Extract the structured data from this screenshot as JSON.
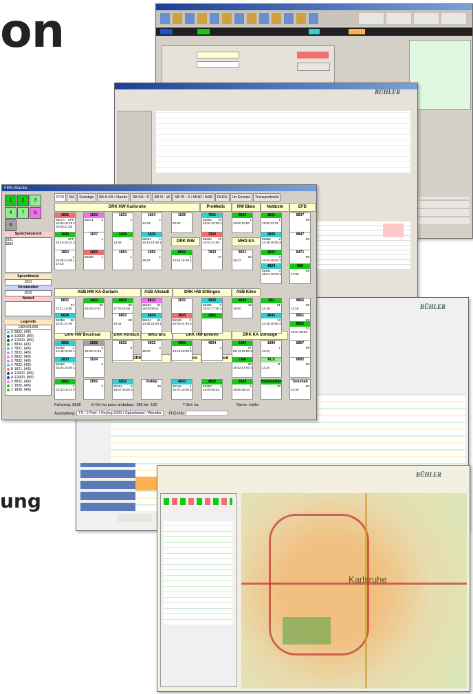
{
  "headings": {
    "line1": "on",
    "line2": "ung"
  },
  "colors": {
    "green": "#14c814",
    "red": "#f07070",
    "cyan": "#30d0d0",
    "magenta": "#f070f0",
    "yellow": "#ffffcc",
    "dark": "#202020",
    "grey": "#a0a0a0",
    "orange": "#ffb050",
    "lightgreen": "#90ee90",
    "pink": "#ffc8c8",
    "white": "#ffffff",
    "blue": "#1c3f94"
  },
  "fms": {
    "title": "FMS-Maske",
    "keypad": [
      "1",
      "2",
      "3",
      "4",
      "7",
      "8",
      "6"
    ],
    "tabs": [
      "RTD",
      "NH",
      "Sonstige",
      "SB A-KA / Hunde",
      "SB KA - N",
      "SB N - W",
      "SB W - Z / MHD / ASB",
      "DLRG",
      "Im Einsatz",
      "Transportziele"
    ],
    "sprechwunsch": {
      "label": "Sprechwunsch",
      "items": [
        "1831",
        "1836"
      ]
    },
    "sprechtaste": {
      "label": "Sprechtaste",
      "value": "1831"
    },
    "verstanden": {
      "label": "Verstanden",
      "value": "3833"
    },
    "notruf": {
      "label": "Notruf"
    },
    "legende": {
      "label": "Legende",
      "code": "1/82/431/836",
      "items": [
        {
          "n": "0",
          "text": "2833, (4/6)"
        },
        {
          "n": "A",
          "text": "E3000, (8/9)"
        },
        {
          "n": "A",
          "text": "E3000, (8/9)"
        },
        {
          "n": "1",
          "text": "8834, (4/6)"
        },
        {
          "n": "2",
          "text": "7831, (4/6)"
        },
        {
          "n": "3",
          "text": "3833, (4/6)"
        },
        {
          "n": "3",
          "text": "8832, (4/6)"
        },
        {
          "n": "3",
          "text": "7832, (4/6)"
        },
        {
          "n": "4",
          "text": "7832, (4/6)"
        },
        {
          "n": "8",
          "text": "1821, (4/6)"
        },
        {
          "n": "A",
          "text": "E3000, (8/9)"
        },
        {
          "n": "A",
          "text": "E3000, (8/9)"
        },
        {
          "n": "3",
          "text": "8832, (4/6)"
        },
        {
          "n": "1",
          "text": "1836, (4/6)"
        },
        {
          "n": "1",
          "text": "1836, (4/6)"
        }
      ]
    },
    "groups": [
      {
        "label": "DRK HW Karlsruhe"
      },
      {
        "label": "ProMedic"
      },
      {
        "label": "RW Blalo"
      },
      {
        "label": "Notärzte"
      },
      {
        "label": "EFD"
      },
      {
        "label": "DRK WW"
      },
      {
        "label": "MHD KA"
      },
      {
        "label": "ASB HW KA-Durlach"
      },
      {
        "label": "ASB Altstadt"
      },
      {
        "label": "DRK HW Ettlingen"
      },
      {
        "label": "ASB Kliko"
      },
      {
        "label": "DRK HW Bruchsal"
      },
      {
        "label": "DRK Kirrlach"
      },
      {
        "label": "MHD Bru"
      },
      {
        "label": "DRK HW Bretten"
      },
      {
        "label": "DRK KA Sonstige"
      },
      {
        "label": "DRK Phil"
      },
      {
        "label": "DRK Menz"
      },
      {
        "label": "DRK Oberd"
      }
    ],
    "cells": [
      {
        "id": "1831",
        "a": "65270",
        "b": "SPP",
        "c": "15:06",
        "d": "18:18",
        "e": "15:44",
        "f": "19:00",
        "g": "21:38"
      },
      {
        "id": "1832",
        "a": "65271",
        "b": "5",
        "c": "",
        "d": "",
        "e": "",
        "f": "",
        "g": ""
      },
      {
        "id": "1833",
        "a": "",
        "b": "1",
        "c": "",
        "d": "",
        "e": "",
        "f": "",
        "g": ""
      },
      {
        "id": "1834",
        "a": "",
        "b": "1",
        "c": "14:33",
        "d": "",
        "e": "",
        "f": "",
        "g": ""
      },
      {
        "id": "1835",
        "a": "",
        "b": "",
        "c": "22:52",
        "d": "",
        "e": "",
        "f": "",
        "g": ""
      },
      {
        "id": "7831",
        "a": "65252",
        "b": "78",
        "c": "15:04",
        "d": "22:00",
        "e": "12:58",
        "f": "",
        "g": ""
      },
      {
        "id": "5831",
        "a": "",
        "b": "1",
        "c": "18:00",
        "d": "10:50",
        "e": "",
        "f": "",
        "g": ""
      },
      {
        "id": "1821",
        "a": "",
        "b": "1",
        "c": "19:00",
        "d": "11:34",
        "e": "",
        "f": "",
        "g": ""
      },
      {
        "id": "8837",
        "a": "",
        "b": "99",
        "c": "",
        "d": "",
        "e": "",
        "f": "",
        "g": ""
      },
      {
        "id": "1836",
        "a": "",
        "b": "SPP",
        "c": "15:18",
        "d": "20:12",
        "e": "18:00",
        "f": "",
        "g": ""
      },
      {
        "id": "1837",
        "a": "",
        "b": "1",
        "c": "",
        "d": "",
        "e": "",
        "f": "",
        "g": ""
      },
      {
        "id": "1838",
        "a": "",
        "b": "1",
        "c": "14:36",
        "d": "",
        "e": "",
        "f": "",
        "g": ""
      },
      {
        "id": "1839",
        "a": "65251",
        "b": "1",
        "c": "15:12",
        "d": "14:36",
        "e": "16:42",
        "f": "",
        "g": ""
      },
      {
        "id": "7832",
        "a": "65264",
        "b": "78",
        "c": "15:01",
        "d": "21:00",
        "e": "",
        "f": "",
        "g": ""
      },
      {
        "id": "2825",
        "a": "65256",
        "b": "2",
        "c": "14:49",
        "d": "19:00",
        "e": "20:11",
        "f": "",
        "g": ""
      },
      {
        "id": "8847",
        "a": "",
        "b": "99",
        "c": "",
        "d": "",
        "e": "",
        "f": "",
        "g": ""
      },
      {
        "id": "1852",
        "a": "",
        "b": "1",
        "c": "13:36",
        "d": "14:58",
        "e": "17:12",
        "f": "17:18",
        "g": ""
      },
      {
        "id": "1853",
        "a": "65265",
        "b": "1",
        "c": "",
        "d": "",
        "e": "",
        "f": "",
        "g": ""
      },
      {
        "id": "1854",
        "a": "",
        "b": "1",
        "c": "",
        "d": "",
        "e": "",
        "f": "",
        "g": ""
      },
      {
        "id": "1855",
        "a": "",
        "b": "1",
        "c": "19:33",
        "d": "",
        "e": "",
        "f": "",
        "g": ""
      },
      {
        "id": "8832",
        "a": "",
        "b": "1",
        "c": "14:51",
        "d": "16:00",
        "e": "15:25",
        "f": "",
        "g": ""
      },
      {
        "id": "7833",
        "a": "",
        "b": "70",
        "c": "",
        "d": "",
        "e": "",
        "f": "",
        "g": ""
      },
      {
        "id": "9831",
        "a": "",
        "b": "90",
        "c": "19:47",
        "d": "",
        "e": "",
        "f": "",
        "g": ""
      },
      {
        "id": "3822",
        "a": "",
        "b": "3",
        "c": "13:54",
        "d": "19:00",
        "e": "11:00",
        "f": "",
        "g": ""
      },
      {
        "id": "8471",
        "a": "",
        "b": "99",
        "c": "",
        "d": "",
        "e": "",
        "f": "",
        "g": ""
      },
      {
        "id": "4824",
        "a": "65261",
        "b": "4",
        "c": "15:01",
        "d": "19:00",
        "e": "15:57",
        "f": "",
        "g": ""
      },
      {
        "id": "886",
        "a": "",
        "b": "99",
        "c": "17:00",
        "d": "",
        "e": "",
        "f": "",
        "g": ""
      },
      {
        "id": "8831",
        "a": "",
        "b": "81",
        "c": "21:11",
        "d": "14:55",
        "e": "",
        "f": "",
        "g": ""
      },
      {
        "id": "3833",
        "a": "",
        "b": "80",
        "c": "20:00",
        "d": "13:57",
        "e": "",
        "f": "",
        "g": ""
      },
      {
        "id": "8835",
        "a": "",
        "b": "80",
        "c": "17:00",
        "d": "15:08",
        "e": "",
        "f": "",
        "g": ""
      },
      {
        "id": "8832",
        "a": "65252",
        "b": "81",
        "c": "18:00",
        "d": "08:01",
        "e": "",
        "f": "",
        "g": ""
      },
      {
        "id": "3831",
        "a": "",
        "b": "",
        "c": "",
        "d": "",
        "e": "",
        "f": "",
        "g": ""
      },
      {
        "id": "3832",
        "a": "65255",
        "b": "3",
        "c": "16:57",
        "d": "17:00",
        "e": "14:51",
        "f": "",
        "g": ""
      },
      {
        "id": "8839",
        "a": "",
        "b": "32",
        "c": "19:00",
        "d": "",
        "e": "",
        "f": "",
        "g": ""
      },
      {
        "id": "381",
        "a": "",
        "b": "81",
        "c": "14:39",
        "d": "",
        "e": "",
        "f": "",
        "g": ""
      },
      {
        "id": "8865",
        "a": "",
        "b": "99",
        "c": "11:16",
        "d": "",
        "e": "",
        "f": "",
        "g": ""
      },
      {
        "id": "6838",
        "a": "65258",
        "b": "80",
        "c": "15:01",
        "d": "21:00",
        "e": "",
        "f": "",
        "g": ""
      },
      {
        "id": "8853",
        "a": "",
        "b": "80",
        "c": "20:44",
        "d": "",
        "e": "",
        "f": "",
        "g": ""
      },
      {
        "id": "6834",
        "a": "65244",
        "b": "81",
        "c": "14:55",
        "d": "21:00",
        "e": "14:54",
        "f": "",
        "g": ""
      },
      {
        "id": "3833",
        "a": "65246",
        "b": "3",
        "c": "22:00",
        "d": "14:46",
        "e": "16:12",
        "f": "",
        "g": ""
      },
      {
        "id": "3851",
        "a": "",
        "b": "",
        "c": "",
        "d": "",
        "e": "",
        "f": "",
        "g": ""
      },
      {
        "id": "8843",
        "a": "",
        "b": "13",
        "c": "14:48",
        "d": "19:50",
        "e": "21:44",
        "f": "",
        "g": ""
      },
      {
        "id": "8851",
        "a": "",
        "b": "99",
        "c": "",
        "d": "",
        "e": "",
        "f": "",
        "g": ""
      },
      {
        "id": "2831",
        "a": "65262",
        "b": "2",
        "c": "14:48",
        "d": "19:00",
        "e": "14:49",
        "f": "",
        "g": ""
      },
      {
        "id": "2832",
        "a": "",
        "b": "5",
        "c": "19:00",
        "d": "12:44",
        "e": "",
        "f": "",
        "g": ""
      },
      {
        "id": "6832",
        "a": "",
        "b": "6",
        "c": "",
        "d": "",
        "e": "",
        "f": "",
        "g": ""
      },
      {
        "id": "9832",
        "a": "",
        "b": "2",
        "c": "19:00",
        "d": "",
        "e": "",
        "f": "",
        "g": ""
      },
      {
        "id": "4831",
        "a": "",
        "b": "4",
        "c": "13:15",
        "d": "19:00",
        "e": "16:21",
        "f": "",
        "g": ""
      },
      {
        "id": "4834",
        "a": "",
        "b": "4",
        "c": "",
        "d": "",
        "e": "",
        "f": "",
        "g": ""
      },
      {
        "id": "1380",
        "a": "",
        "b": "97",
        "c": "08:13",
        "d": "18:00",
        "e": "15:53",
        "f": "",
        "g": ""
      },
      {
        "id": "1890",
        "a": "",
        "b": "1",
        "c": "11:34",
        "d": "",
        "e": "",
        "f": "",
        "g": ""
      },
      {
        "id": "8822",
        "a": "",
        "b": "70",
        "c": "16:57",
        "d": "08:00",
        "e": "",
        "f": "",
        "g": ""
      },
      {
        "id": "2833",
        "a": "65269",
        "b": "2",
        "c": "15:02",
        "d": "18:00",
        "e": "14:32",
        "f": "",
        "g": ""
      },
      {
        "id": "2834",
        "a": "",
        "b": "2",
        "c": "",
        "d": "",
        "e": "",
        "f": "",
        "g": ""
      },
      {
        "id": "LNA",
        "a": "",
        "b": "95",
        "c": "16:52",
        "d": "17:00",
        "e": "15:04",
        "f": "",
        "g": ""
      },
      {
        "id": "RLS",
        "a": "",
        "b": "11",
        "c": "11:34",
        "d": "",
        "e": "",
        "f": "",
        "g": ""
      },
      {
        "id": "8867",
        "a": "",
        "b": "99",
        "c": "",
        "d": "",
        "e": "",
        "f": "",
        "g": ""
      },
      {
        "id": "8892",
        "a": "",
        "b": "90",
        "c": "",
        "d": "",
        "e": "",
        "f": "",
        "g": ""
      },
      {
        "id": "2851",
        "a": "",
        "b": "2",
        "c": "13:33",
        "d": "15:12",
        "e": "07:05",
        "f": "",
        "g": ""
      },
      {
        "id": "2852",
        "a": "",
        "b": "2",
        "c": "",
        "d": "",
        "e": "",
        "f": "",
        "g": ""
      },
      {
        "id": "6831",
        "a": "65254",
        "b": "6",
        "c": "16:57",
        "d": "20:00",
        "e": "16:17",
        "f": "",
        "g": ""
      },
      {
        "id": "rtwkkp",
        "a": "",
        "b": "30",
        "c": "",
        "d": "",
        "e": "",
        "f": "",
        "g": ""
      },
      {
        "id": "4833",
        "a": "65248",
        "b": "4",
        "c": "14:07",
        "d": "19:00",
        "e": "16:57",
        "f": "",
        "g": ""
      },
      {
        "id": "4832",
        "a": "65250",
        "b": "4",
        "c": "18:00",
        "d": "08:34",
        "e": "",
        "f": "",
        "g": ""
      },
      {
        "id": "1829",
        "a": "",
        "b": "1",
        "c": "18:00",
        "d": "18:44",
        "e": "",
        "f": "",
        "g": ""
      },
      {
        "id": "Intensivtrans.",
        "a": "",
        "b": "37",
        "c": "",
        "d": "",
        "e": "",
        "f": "",
        "g": ""
      },
      {
        "id": "Taxumaß",
        "a": "",
        "b": "99",
        "c": "14:30",
        "d": "",
        "e": "",
        "f": "",
        "g": ""
      }
    ],
    "status": {
      "fahrzeug_label": "Fahrzeug:",
      "fahrzeug": "8838",
      "eort_label": "E-Ort:",
      "eort": "ka parra ambulanz -168 bis -162",
      "tziel_label": "T-Ziel:",
      "tziel": "ka",
      "name_label": "Name:",
      "name": "müller",
      "ausstattung_label": "Ausstattung:",
      "ausstattung": "TS / 2 Perf. / Oxylog 2000 / Spineboard / Wandler",
      "fhz_label": "FHZ-Info:"
    }
  },
  "backwin": {
    "title": "BÜHLER"
  },
  "map": {
    "city": "Karlsruhe"
  }
}
